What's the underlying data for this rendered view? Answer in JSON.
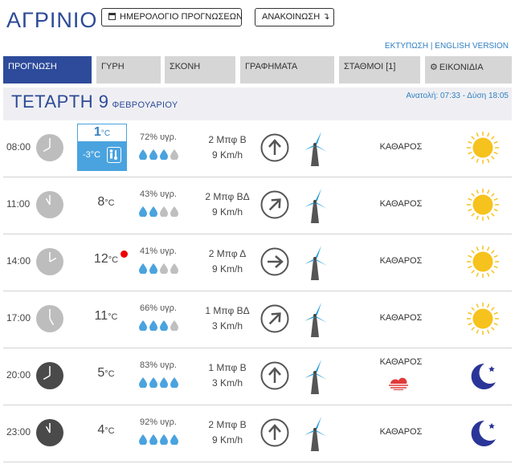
{
  "header": {
    "city": "ΑΓΡΙΝΙΟ",
    "calendar_button": "ΗΜΕΡΟΛΟΓΙΟ ΠΡΟΓΝΩΣΕΩΝ",
    "news_button": "ΑΝΑΚΟΙΝΩΣΗ ↴",
    "print_link": "ΕΚΤΥΠΩΣΗ",
    "separator": " | ",
    "english_link": "ENGLISH VERSION"
  },
  "tabs": [
    {
      "label": "ΠΡΟΓΝΩΣΗ",
      "active": true
    },
    {
      "label": "ΓΥΡΗ"
    },
    {
      "label": "ΣΚΟΝΗ"
    },
    {
      "label": "ΓΡΑΦΗΜΑΤΑ"
    },
    {
      "label": "ΣΤΑΘΜΟΙ [1]"
    },
    {
      "label": "ΕΙΚΟΝΙΔΙΑ",
      "icon": "gear-icon"
    }
  ],
  "day": {
    "title": "ΤΕΤΑΡΤΗ 9",
    "month": "ΦΕΒΡΟΥΑΡΙΟΥ",
    "sun_times": "Ανατολή: 07:33 - Δύση 18:05"
  },
  "colors": {
    "brand_blue": "#2c4a96",
    "link_blue": "#2f7fc1",
    "drop_filled": "#4aa3df",
    "drop_empty": "#bfbfbf",
    "sun": "#f6c21d",
    "moon": "#2a3599",
    "alert_red": "#e00000"
  },
  "forecast": [
    {
      "time": "08:00",
      "clock": "day",
      "temp": "1",
      "unit": "°C",
      "feels": "-3°C",
      "feels_icon": "feels-like-icon",
      "humidity": "72% υγρ.",
      "drops": 3,
      "wind_force": "2 Μπφ Β",
      "wind_speed": "9 Km/h",
      "wind_dir": "N",
      "condition": "ΚΑΘΑΡΟΣ",
      "icon": "sun-icon"
    },
    {
      "time": "11:00",
      "clock": "day",
      "temp": "8",
      "unit": "°C",
      "humidity": "43% υγρ.",
      "drops": 2,
      "wind_force": "2 Μπφ ΒΔ",
      "wind_speed": "9 Km/h",
      "wind_dir": "NW",
      "condition": "ΚΑΘΑΡΟΣ",
      "icon": "sun-icon"
    },
    {
      "time": "14:00",
      "clock": "day",
      "temp": "12",
      "unit": "°C",
      "alert": true,
      "humidity": "41% υγρ.",
      "drops": 2,
      "wind_force": "2 Μπφ Δ",
      "wind_speed": "9 Km/h",
      "wind_dir": "W",
      "condition": "ΚΑΘΑΡΟΣ",
      "icon": "sun-icon"
    },
    {
      "time": "17:00",
      "clock": "day",
      "temp": "11",
      "unit": "°C",
      "humidity": "66% υγρ.",
      "drops": 3,
      "wind_force": "1 Μπφ ΒΔ",
      "wind_speed": "3 Km/h",
      "wind_dir": "NW",
      "condition": "ΚΑΘΑΡΟΣ",
      "icon": "sun-icon"
    },
    {
      "time": "20:00",
      "clock": "night",
      "temp": "5",
      "unit": "°C",
      "humidity": "83% υγρ.",
      "drops": 4,
      "wind_force": "1 Μπφ Β",
      "wind_speed": "3 Km/h",
      "wind_dir": "N",
      "condition": "ΚΑΘΑΡΟΣ",
      "mist": true,
      "icon": "moon-icon"
    },
    {
      "time": "23:00",
      "clock": "night",
      "temp": "4",
      "unit": "°C",
      "humidity": "92% υγρ.",
      "drops": 4,
      "wind_force": "2 Μπφ Β",
      "wind_speed": "9 Km/h",
      "wind_dir": "N",
      "condition": "ΚΑΘΑΡΟΣ",
      "icon": "moon-icon"
    }
  ]
}
